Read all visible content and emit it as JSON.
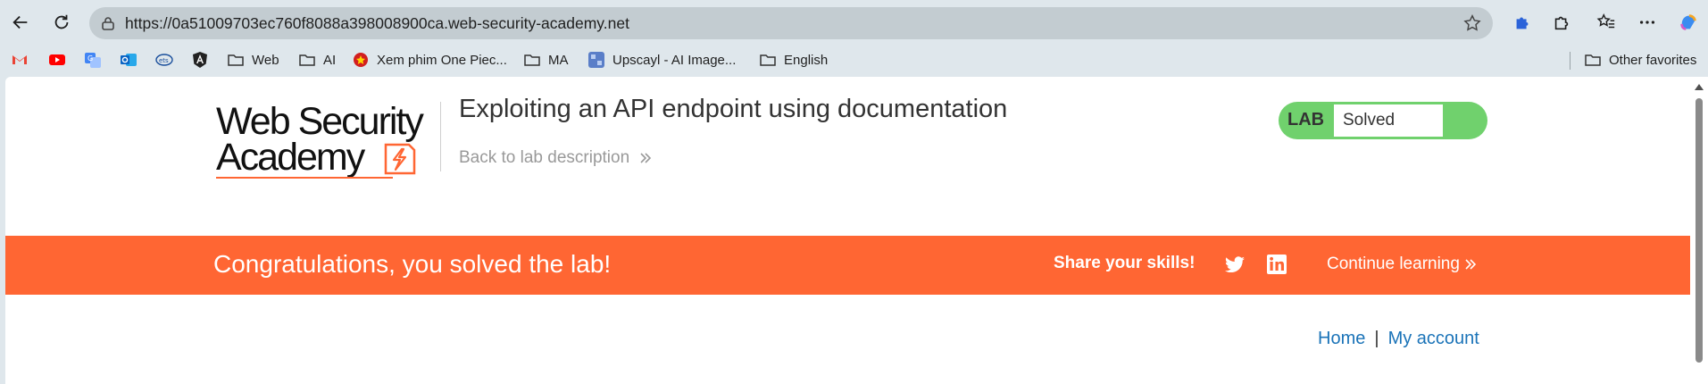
{
  "browser": {
    "url": "https://0a51009703ec760f8088a398008900ca.web-security-academy.net"
  },
  "bookmarks": [
    {
      "label": "",
      "icon": "gmail-icon"
    },
    {
      "label": "",
      "icon": "youtube-icon"
    },
    {
      "label": "",
      "icon": "translate-icon"
    },
    {
      "label": "",
      "icon": "outlook-icon"
    },
    {
      "label": "",
      "icon": "ets-icon"
    },
    {
      "label": "",
      "icon": "angular-icon"
    },
    {
      "label": "Web",
      "icon": "folder-icon"
    },
    {
      "label": "AI",
      "icon": "folder-icon"
    },
    {
      "label": "Xem phim One Piec...",
      "icon": "site-icon"
    },
    {
      "label": "MA",
      "icon": "folder-icon"
    },
    {
      "label": "Upscayl - AI Image...",
      "icon": "app-icon"
    },
    {
      "label": "English",
      "icon": "folder-icon"
    }
  ],
  "other_favorites": "Other favorites",
  "page": {
    "logo_line1": "Web Security",
    "logo_line2": "Academy",
    "title": "Exploiting an API endpoint using documentation",
    "back_link": "Back to lab description",
    "lab_tag": "LAB",
    "lab_status": "Solved",
    "banner": {
      "message": "Congratulations, you solved the lab!",
      "share": "Share your skills!",
      "continue": "Continue learning"
    },
    "nav": {
      "home": "Home",
      "separator": "|",
      "account": "My account"
    }
  },
  "colors": {
    "accent": "#ff6633",
    "status_green": "#70d16d",
    "link": "#1a73b8"
  }
}
